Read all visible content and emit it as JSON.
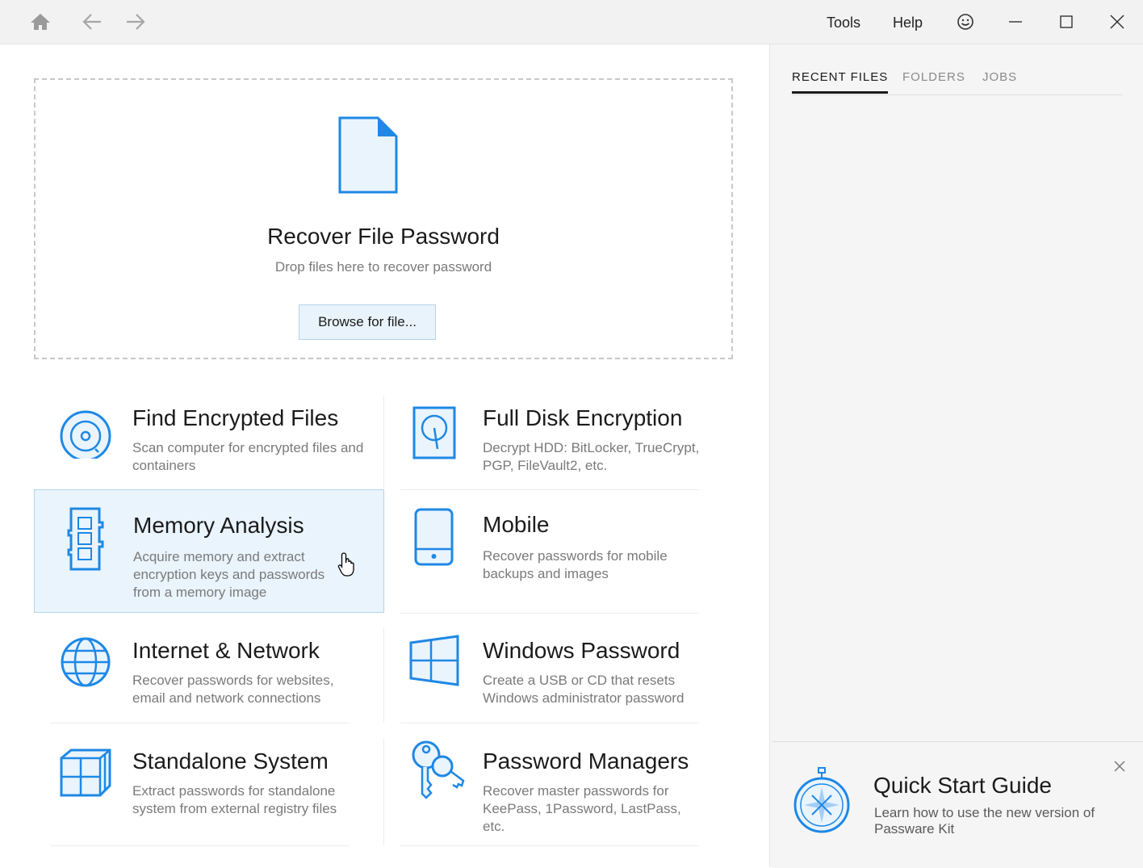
{
  "titlebar": {
    "nav_icons": [
      "home-icon",
      "back-arrow-icon",
      "forward-arrow-icon"
    ],
    "tools_label": "Tools",
    "help_label": "Help",
    "window_controls": [
      "smiley-feedback-icon",
      "minimize-icon",
      "maximize-icon",
      "close-icon"
    ]
  },
  "dropzone": {
    "title": "Recover File Password",
    "subtitle": "Drop files here to recover password",
    "browse_label": "Browse for file...",
    "icon": "file-icon"
  },
  "cards": [
    {
      "id": "find-encrypted-files",
      "title": "Find Encrypted Files",
      "description": "Scan computer for encrypted files and containers",
      "icon": "disc-scan-icon"
    },
    {
      "id": "full-disk-encryption",
      "title": "Full Disk Encryption",
      "description": "Decrypt HDD: BitLocker, TrueCrypt, PGP, FileVault2, etc.",
      "icon": "hard-disk-icon"
    },
    {
      "id": "memory-analysis",
      "title": "Memory Analysis",
      "description": "Acquire memory and extract encryption keys and passwords from a memory image",
      "icon": "memory-chip-icon"
    },
    {
      "id": "mobile",
      "title": "Mobile",
      "description": "Recover passwords for mobile backups and images",
      "icon": "mobile-phone-icon"
    },
    {
      "id": "internet-network",
      "title": "Internet & Network",
      "description": "Recover passwords for websites, email and network connections",
      "icon": "globe-icon"
    },
    {
      "id": "windows-password",
      "title": "Windows Password",
      "description": "Create a USB or CD that resets Windows administrator password",
      "icon": "windows-logo-icon"
    },
    {
      "id": "standalone-system",
      "title": "Standalone System",
      "description": "Extract passwords for standalone system from external registry files",
      "icon": "cube-blocks-icon"
    },
    {
      "id": "password-managers",
      "title": "Password Managers",
      "description": "Recover master passwords for KeePass, 1Password, LastPass, etc.",
      "icon": "keys-icon"
    }
  ],
  "right_panel": {
    "tabs": [
      {
        "label": "RECENT FILES",
        "active": true
      },
      {
        "label": "FOLDERS",
        "active": false
      },
      {
        "label": "JOBS",
        "active": false
      }
    ],
    "quick_start": {
      "title": "Quick Start Guide",
      "description": "Learn how to use the new version of Passware Kit",
      "icon": "compass-stopwatch-icon"
    }
  },
  "colors": {
    "accent": "#1e88e5",
    "highlight_bg": "#e9f4fc",
    "highlight_border": "#b4d4ec",
    "titlebar_bg": "#f2f2f2",
    "panel_bg": "#f5f5f5"
  }
}
